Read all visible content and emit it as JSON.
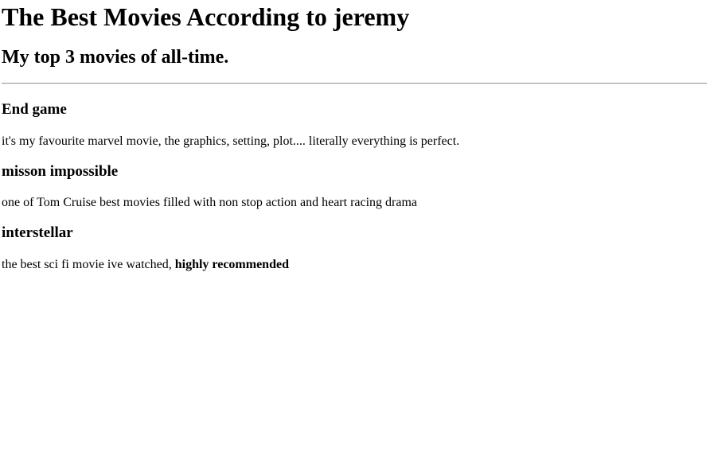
{
  "header": {
    "title": "The Best Movies According to jeremy",
    "subtitle": "My top 3 movies of all-time."
  },
  "movies": [
    {
      "title": "End game",
      "description": "it's my favourite marvel movie, the graphics, setting, plot.... literally everything is perfect.",
      "emphasis": ""
    },
    {
      "title": "misson impossible",
      "description": "one of Tom Cruise best movies filled with non stop action and heart racing drama",
      "emphasis": ""
    },
    {
      "title": "interstellar",
      "description": "the best sci fi movie ive watched, ",
      "emphasis": "highly recommended"
    }
  ]
}
